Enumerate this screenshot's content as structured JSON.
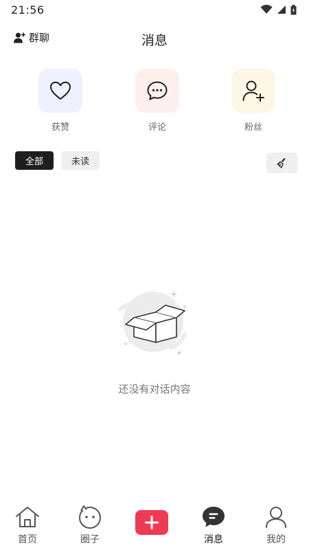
{
  "status_bar": {
    "time": "21:56",
    "icons": [
      "wifi-icon",
      "signal-icon",
      "battery-icon"
    ]
  },
  "header": {
    "group_chat_label": "群聊",
    "title": "消息"
  },
  "categories": [
    {
      "label": "获赞",
      "icon": "heart-icon",
      "bg": "#eef2ff"
    },
    {
      "label": "评论",
      "icon": "comment-bubble-icon",
      "bg": "#fdf0ec"
    },
    {
      "label": "粉丝",
      "icon": "add-user-icon",
      "bg": "#fdf8e6"
    }
  ],
  "filters": {
    "all_label": "全部",
    "unread_label": "未读",
    "clear_icon": "broom-icon"
  },
  "empty_state": {
    "icon": "empty-box-icon",
    "text": "还没有对话内容"
  },
  "bottom_nav": [
    {
      "label": "首页",
      "icon": "home-icon"
    },
    {
      "label": "圈子",
      "icon": "circle-face-icon"
    },
    {
      "label": "",
      "icon": "plus-icon"
    },
    {
      "label": "消息",
      "icon": "message-icon",
      "active": true
    },
    {
      "label": "我的",
      "icon": "profile-icon"
    }
  ],
  "colors": {
    "accent": "#ef3a53",
    "dark": "#1e1e1e",
    "chip_bg": "#efefef"
  }
}
